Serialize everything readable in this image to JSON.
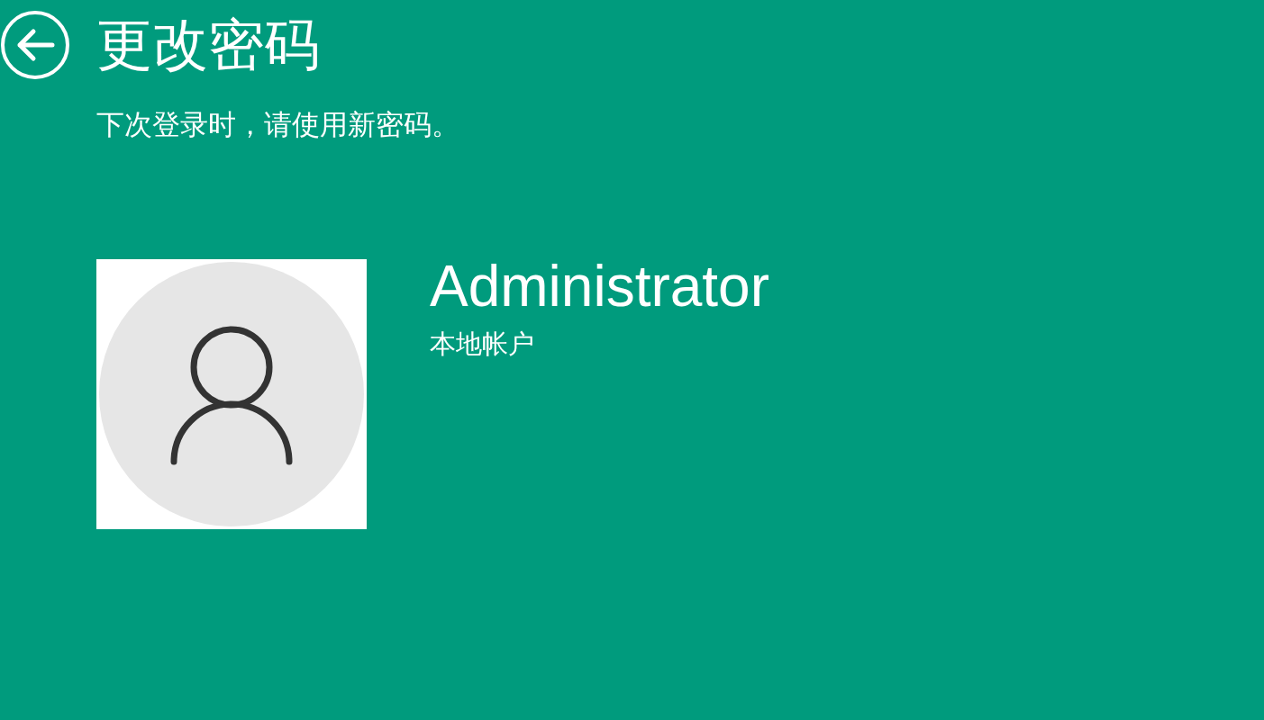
{
  "header": {
    "title": "更改密码",
    "subtitle": "下次登录时，请使用新密码。"
  },
  "account": {
    "name": "Administrator",
    "type": "本地帐户"
  }
}
